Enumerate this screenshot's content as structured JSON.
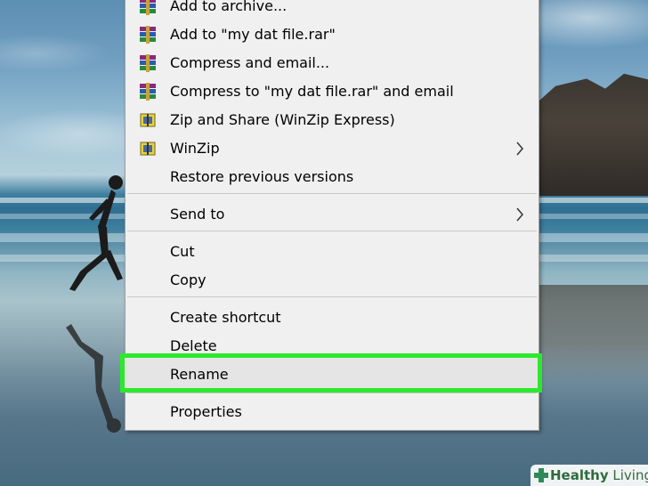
{
  "menu": {
    "items": [
      {
        "label": "Add to archive...",
        "icon": "winrar-icon"
      },
      {
        "label": "Add to \"my dat file.rar\"",
        "icon": "winrar-icon"
      },
      {
        "label": "Compress and email...",
        "icon": "winrar-icon"
      },
      {
        "label": "Compress to \"my dat file.rar\" and email",
        "icon": "winrar-icon"
      },
      {
        "label": "Zip and Share (WinZip Express)",
        "icon": "winzip-icon"
      },
      {
        "label": "WinZip",
        "icon": "winzip-icon",
        "submenu": true
      },
      {
        "label": "Restore previous versions"
      },
      {
        "label": "Send to",
        "submenu": true
      },
      {
        "label": "Cut"
      },
      {
        "label": "Copy"
      },
      {
        "label": "Create shortcut"
      },
      {
        "label": "Delete"
      },
      {
        "label": "Rename",
        "highlighted": true
      },
      {
        "label": "Properties"
      }
    ]
  },
  "highlight_color": "#2ee82e",
  "watermark": {
    "word1": "Healthy",
    "word2": "Living"
  }
}
